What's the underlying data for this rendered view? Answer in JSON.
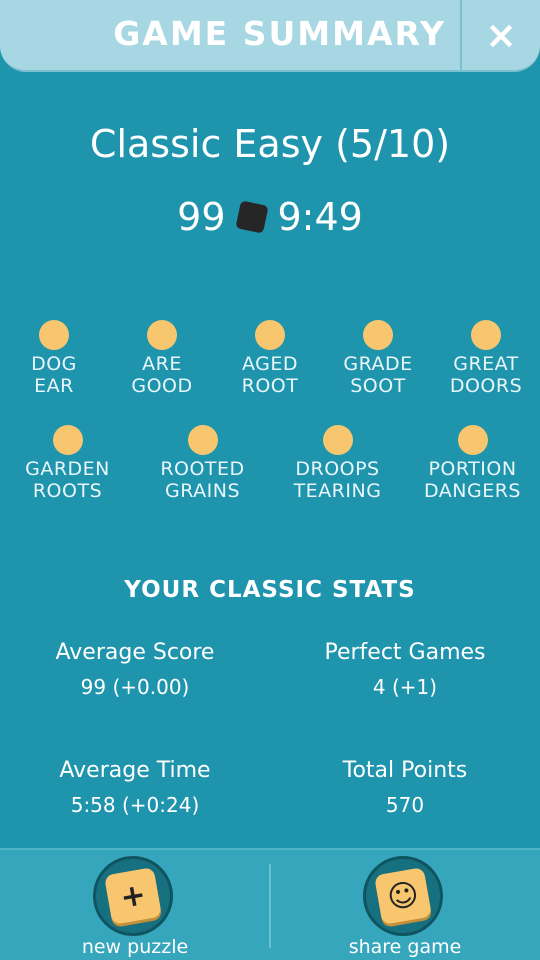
{
  "header": {
    "title": "GAME SUMMARY",
    "close_icon": "×"
  },
  "puzzle": {
    "title": "Classic Easy (5/10)",
    "score": "99",
    "time": "9:49"
  },
  "words": {
    "row1": [
      {
        "line1": "DOG",
        "line2": "EAR"
      },
      {
        "line1": "ARE",
        "line2": "GOOD"
      },
      {
        "line1": "AGED",
        "line2": "ROOT"
      },
      {
        "line1": "GRADE",
        "line2": "SOOT"
      },
      {
        "line1": "GREAT",
        "line2": "DOORS"
      }
    ],
    "row2": [
      {
        "line1": "GARDEN",
        "line2": "ROOTS"
      },
      {
        "line1": "ROOTED",
        "line2": "GRAINS"
      },
      {
        "line1": "DROOPS",
        "line2": "TEARING"
      },
      {
        "line1": "PORTION",
        "line2": "DANGERS"
      }
    ],
    "dot_color": "#f8c66f"
  },
  "stats": {
    "heading": "YOUR CLASSIC STATS",
    "average_score": {
      "label": "Average Score",
      "value": "99 (+0.00)"
    },
    "perfect_games": {
      "label": "Perfect Games",
      "value": "4 (+1)"
    },
    "average_time": {
      "label": "Average Time",
      "value": "5:58 (+0:24)"
    },
    "total_points": {
      "label": "Total Points",
      "value": "570"
    }
  },
  "bottom_bar": {
    "new_puzzle": {
      "label": "new puzzle",
      "icon": "plus-icon",
      "glyph": "+"
    },
    "share_game": {
      "label": "share game",
      "icon": "smiley-icon",
      "glyph": "☺"
    }
  },
  "colors": {
    "background": "#1f94ad",
    "header": "#a7d7e2",
    "accent": "#f8c66f",
    "bottom_bar": "#36a6bc"
  }
}
